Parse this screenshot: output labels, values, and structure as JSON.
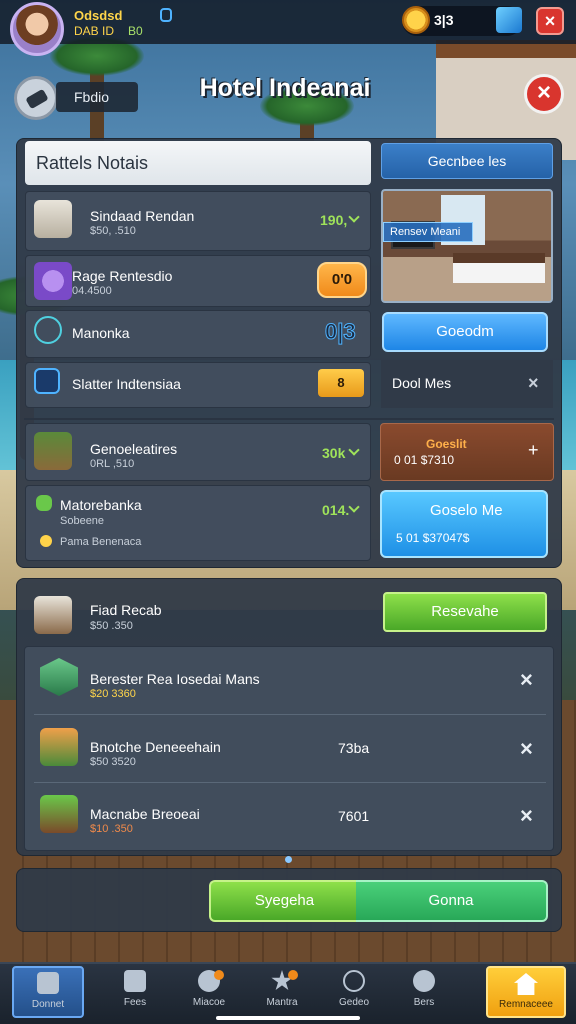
{
  "player": {
    "name": "Odsdsd",
    "level": "0",
    "sub_a": "DAB ID",
    "sub_b": "B0"
  },
  "currency": {
    "coins": "3|3"
  },
  "header": {
    "back_label": "Fbdio",
    "title": "Hotel Indeanai"
  },
  "search": {
    "value": "Rattels Notais"
  },
  "top_tab": {
    "label": "Gecnbee les"
  },
  "rows": [
    {
      "title": "Sindaad Rendan",
      "sub": "$50, .510",
      "value": "190,"
    },
    {
      "title": "Rage Rentesdio",
      "sub": "04.4500",
      "chip": "0'0"
    },
    {
      "title": "Manonka",
      "chip": "0|3"
    },
    {
      "title": "Slatter Indtensiaa",
      "chip": "8"
    }
  ],
  "room": {
    "badge": "Rensev Meani",
    "button": "Goeodm"
  },
  "dark_row": {
    "label": "Dool Mes",
    "close": "×"
  },
  "section_b": {
    "row1": {
      "title": "Genoeleatires",
      "sub": "0RL ,510",
      "value": "30k"
    },
    "row2": {
      "title": "Matorebanka",
      "sub": "Sobeene",
      "sub2": "Pama Benenaca",
      "value": "014."
    },
    "brown_card": {
      "title": "Goeslit",
      "sub": "0 01 $7310",
      "plus": "+"
    },
    "cyan_card": {
      "title": "Goselo Me",
      "sub": "5 01 $37047$"
    }
  },
  "section_c": {
    "header_title": "Fiad Recab",
    "header_sub": "$50 .350",
    "button": "Resevahe",
    "items": [
      {
        "title": "Berester Rea Iosedai Mans",
        "sub": "$20 3360",
        "value": "",
        "close": "×"
      },
      {
        "title": "Bnotche Deneeehain",
        "sub": "$50 3520",
        "value": "73ba",
        "close": "×"
      },
      {
        "title": "Macnabe Breoeai",
        "sub": "$10 .350",
        "value": "7601",
        "close": "×"
      }
    ]
  },
  "bottom_actions": {
    "left": "Syegeha",
    "right": "Gonna"
  },
  "nav": [
    {
      "label": "Donnet"
    },
    {
      "label": "Fees"
    },
    {
      "label": "Miacoe"
    },
    {
      "label": "Mantra"
    },
    {
      "label": "Gedeo"
    },
    {
      "label": "Bers"
    },
    {
      "label": "Remnaceee"
    }
  ],
  "colors": {
    "accent_green": "#9fe35a",
    "accent_blue": "#1e86e6",
    "danger": "#d9352e",
    "coin": "#ffd34a"
  }
}
